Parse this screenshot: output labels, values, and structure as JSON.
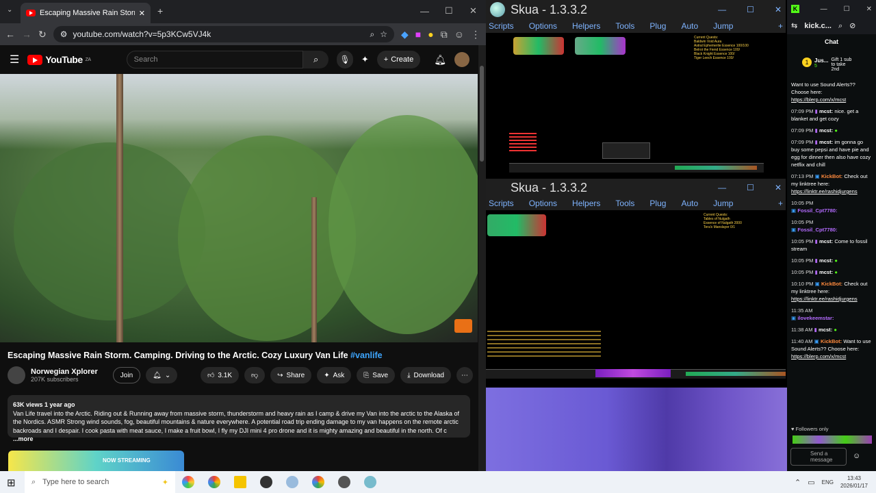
{
  "chrome": {
    "tab_title": "Escaping Massive Rain Storm",
    "url": "youtube.com/watch?v=5p3KCw5VJ4k"
  },
  "youtube": {
    "logo_text": "YouTube",
    "logo_region": "ZA",
    "search_placeholder": "Search",
    "create_label": "Create",
    "video_title": "Escaping Massive Rain Storm. Camping. Driving to the Arctic. Cozy Luxury Van Life",
    "video_hashtag": "#vanlife",
    "channel_name": "Norwegian Xplorer",
    "subscribers": "207K subscribers",
    "join_label": "Join",
    "likes": "3.1K",
    "share_label": "Share",
    "ask_label": "Ask",
    "save_label": "Save",
    "download_label": "Download",
    "views_date": "63K views  1 year ago",
    "description": "Van Life travel into the Arctic. Riding out & Running away from massive storm, thunderstorm and heavy rain as I camp & drive my Van into the arctic to the Alaska of the Nordics. ASMR Strong wind sounds, fog, beautiful mountains & nature everywhere. A potential road trip ending damage to my van happens on the remote arctic backroads and I despair. I cook pasta with meat sauce, I make a fruit bowl, I fly my DJI mini 4 pro drone and it is mighty amazing and beautiful in the north. Of c",
    "more_label": "...more",
    "promo_text": "NOW STREAMING"
  },
  "skua1": {
    "title": "Skua - 1.3.3.2",
    "menu": [
      "Scripts",
      "Options",
      "Helpers",
      "Tools",
      "Plug",
      "Auto",
      "Jump"
    ],
    "quest_title": "Current Quests:",
    "quests": [
      "Baldwin Void Aura",
      "Astral Ephemerite Essence 100/100",
      "Belrot the Fiend Essence 100/",
      "Black Knight Essence 100/",
      "Tiger Leech Essence 100/"
    ]
  },
  "skua2": {
    "title": "Skua - 1.3.3.2",
    "menu": [
      "Scripts",
      "Options",
      "Helpers",
      "Tools",
      "Plug",
      "Auto",
      "Jump"
    ],
    "quest_title": "Current Quests:",
    "quests": [
      "Tables of Nulgath",
      "Essence of Nulgath 2000",
      "Tera's Manslayer 0/1"
    ]
  },
  "kick": {
    "url": "kick.c...",
    "chat_label": "Chat",
    "gift_text": "Gift 1 sub to take 2nd",
    "top_user": "Jus...",
    "top_count": "5",
    "messages": [
      {
        "time": "",
        "user": "",
        "text": "Want to use Sound Alerts?? Choose here:",
        "link": "https://blerp.com/x/mcst"
      },
      {
        "time": "07:09 PM",
        "user": "mcst:",
        "text": "nice. get a blanket and get cozy",
        "link": ""
      },
      {
        "time": "07:09 PM",
        "user": "mcst:",
        "text": "",
        "link": ""
      },
      {
        "time": "07:09 PM",
        "user": "mcst:",
        "text": "im gonna go buy some pepsi and have pie and egg for dinner then also have cozy netflix and chill",
        "link": ""
      },
      {
        "time": "07:13 PM",
        "user": "KickBot:",
        "text": "Check out my linktree here:",
        "link": "https://linktr.ee/rashidjurgens"
      },
      {
        "time": "10:05 PM",
        "user": "Fossil_Cpt7780:",
        "text": "",
        "link": ""
      },
      {
        "time": "10:05 PM",
        "user": "Fossil_Cpt7780:",
        "text": "",
        "link": ""
      },
      {
        "time": "10:05 PM",
        "user": "mcst:",
        "text": "Come to fossil stream",
        "link": ""
      },
      {
        "time": "10:05 PM",
        "user": "mcst:",
        "text": "",
        "link": ""
      },
      {
        "time": "10:05 PM",
        "user": "mcst:",
        "text": "",
        "link": ""
      },
      {
        "time": "10:10 PM",
        "user": "KickBot:",
        "text": "Check out my linktree here:",
        "link": "https://linktr.ee/rashidjurgens"
      },
      {
        "time": "11:35 AM",
        "user": "ilovekeemstar:",
        "text": "",
        "link": ""
      },
      {
        "time": "11:38 AM",
        "user": "mcst:",
        "text": "",
        "link": ""
      },
      {
        "time": "11:40 AM",
        "user": "KickBot:",
        "text": "Want to use Sound Alerts?? Choose here:",
        "link": "https://blerp.com/x/mcst"
      }
    ],
    "followers_only": "Followers only",
    "send_placeholder": "Send a message"
  },
  "taskbar": {
    "search_placeholder": "Type here to search",
    "language": "ENG",
    "time": "13:43",
    "date": "2026/01/17"
  }
}
